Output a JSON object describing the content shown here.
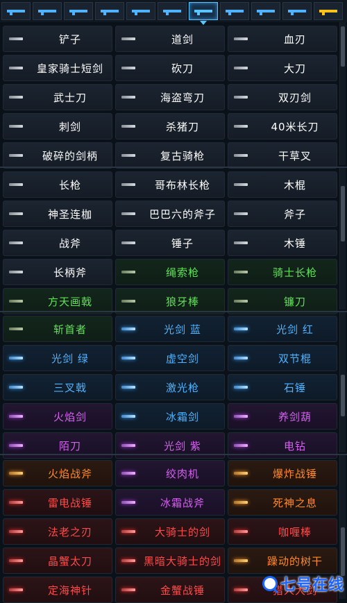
{
  "tabs": [
    {
      "icon": "pistol-icon",
      "color": "#4fb3ff"
    },
    {
      "icon": "rifle-icon",
      "color": "#4fb3ff"
    },
    {
      "icon": "shotgun-icon",
      "color": "#4fb3ff"
    },
    {
      "icon": "heavy-gun-icon",
      "color": "#4fb3ff"
    },
    {
      "icon": "laser-gun-icon",
      "color": "#4fb3ff"
    },
    {
      "icon": "arrow-icon",
      "color": "#4fb3ff"
    },
    {
      "icon": "sword-icon",
      "color": "#5cc4ff",
      "selected": true
    },
    {
      "icon": "spear-icon",
      "color": "#4fb3ff"
    },
    {
      "icon": "shuriken-icon",
      "color": "#4fb3ff"
    },
    {
      "icon": "fish-icon",
      "color": "#4fb3ff"
    },
    {
      "icon": "crown-icon",
      "color": "#ffc21a"
    }
  ],
  "weapons": [
    {
      "row": 0,
      "tier": "white",
      "items": [
        "铲子",
        "道剑",
        "血刃"
      ]
    },
    {
      "row": 1,
      "tier": "white",
      "items": [
        "皇家骑士短剑",
        "砍刀",
        "大刀"
      ]
    },
    {
      "row": 2,
      "tier": "white",
      "items": [
        "武士刀",
        "海盗弯刀",
        "双刃剑"
      ]
    },
    {
      "row": 3,
      "tier": "white",
      "items": [
        "刺剑",
        "杀猪刀",
        "40米长刀"
      ]
    },
    {
      "row": 4,
      "tier": "white",
      "items": [
        "破碎的剑柄",
        "复古骑枪",
        "干草叉"
      ]
    },
    {
      "row": 5,
      "tier": "white",
      "items": [
        "长枪",
        "哥布林长枪",
        "木棍"
      ]
    },
    {
      "row": 6,
      "tier": "white",
      "items": [
        "神圣连枷",
        "巴巴六的斧子",
        "斧子"
      ]
    },
    {
      "row": 7,
      "tier": "white",
      "items": [
        "战斧",
        "锤子",
        "木锤"
      ]
    },
    {
      "row": 8,
      "tier": "mixed",
      "items": [
        "长柄斧",
        "绳索枪",
        "骑士长枪"
      ],
      "tiers": [
        "white",
        "green",
        "green"
      ]
    },
    {
      "row": 9,
      "tier": "green",
      "items": [
        "方天画戟",
        "狼牙棒",
        "镰刀"
      ]
    },
    {
      "row": 10,
      "tier": "mixed",
      "items": [
        "斩首者",
        "光剑 蓝",
        "光剑 红"
      ],
      "tiers": [
        "green",
        "blue",
        "blue"
      ]
    },
    {
      "row": 11,
      "tier": "blue",
      "items": [
        "光剑 绿",
        "虚空剑",
        "双节棍"
      ]
    },
    {
      "row": 12,
      "tier": "blue",
      "items": [
        "三叉戟",
        "激光枪",
        "石锤"
      ]
    },
    {
      "row": 13,
      "tier": "purple",
      "items": [
        "火焰剑",
        "冰霜剑",
        "养剑葫"
      ],
      "tiers": [
        "purple",
        "blue",
        "purple"
      ]
    },
    {
      "row": 14,
      "tier": "purple",
      "items": [
        "陌刀",
        "光剑 紫",
        "电钻"
      ]
    },
    {
      "row": 15,
      "tier": "orange",
      "items": [
        "火焰战斧",
        "绞肉机",
        "爆炸战锤"
      ],
      "tiers": [
        "orange",
        "purple",
        "orange"
      ]
    },
    {
      "row": 16,
      "tier": "mixed",
      "items": [
        "雷电战锤",
        "冰霜战斧",
        "死神之息"
      ],
      "tiers": [
        "red",
        "purple",
        "orange"
      ]
    },
    {
      "row": 17,
      "tier": "red",
      "items": [
        "法老之刃",
        "大骑士的剑",
        "咖喱棒"
      ]
    },
    {
      "row": 18,
      "tier": "red",
      "items": [
        "晶蟹太刀",
        "黑暗大骑士的剑",
        "躁动的树干"
      ],
      "tiers": [
        "red",
        "red",
        "orange"
      ]
    },
    {
      "row": 19,
      "tier": "red",
      "items": [
        "定海神针",
        "金蟹战锤",
        "猎人大剑"
      ]
    }
  ],
  "watermark": {
    "text": "七号在线"
  }
}
